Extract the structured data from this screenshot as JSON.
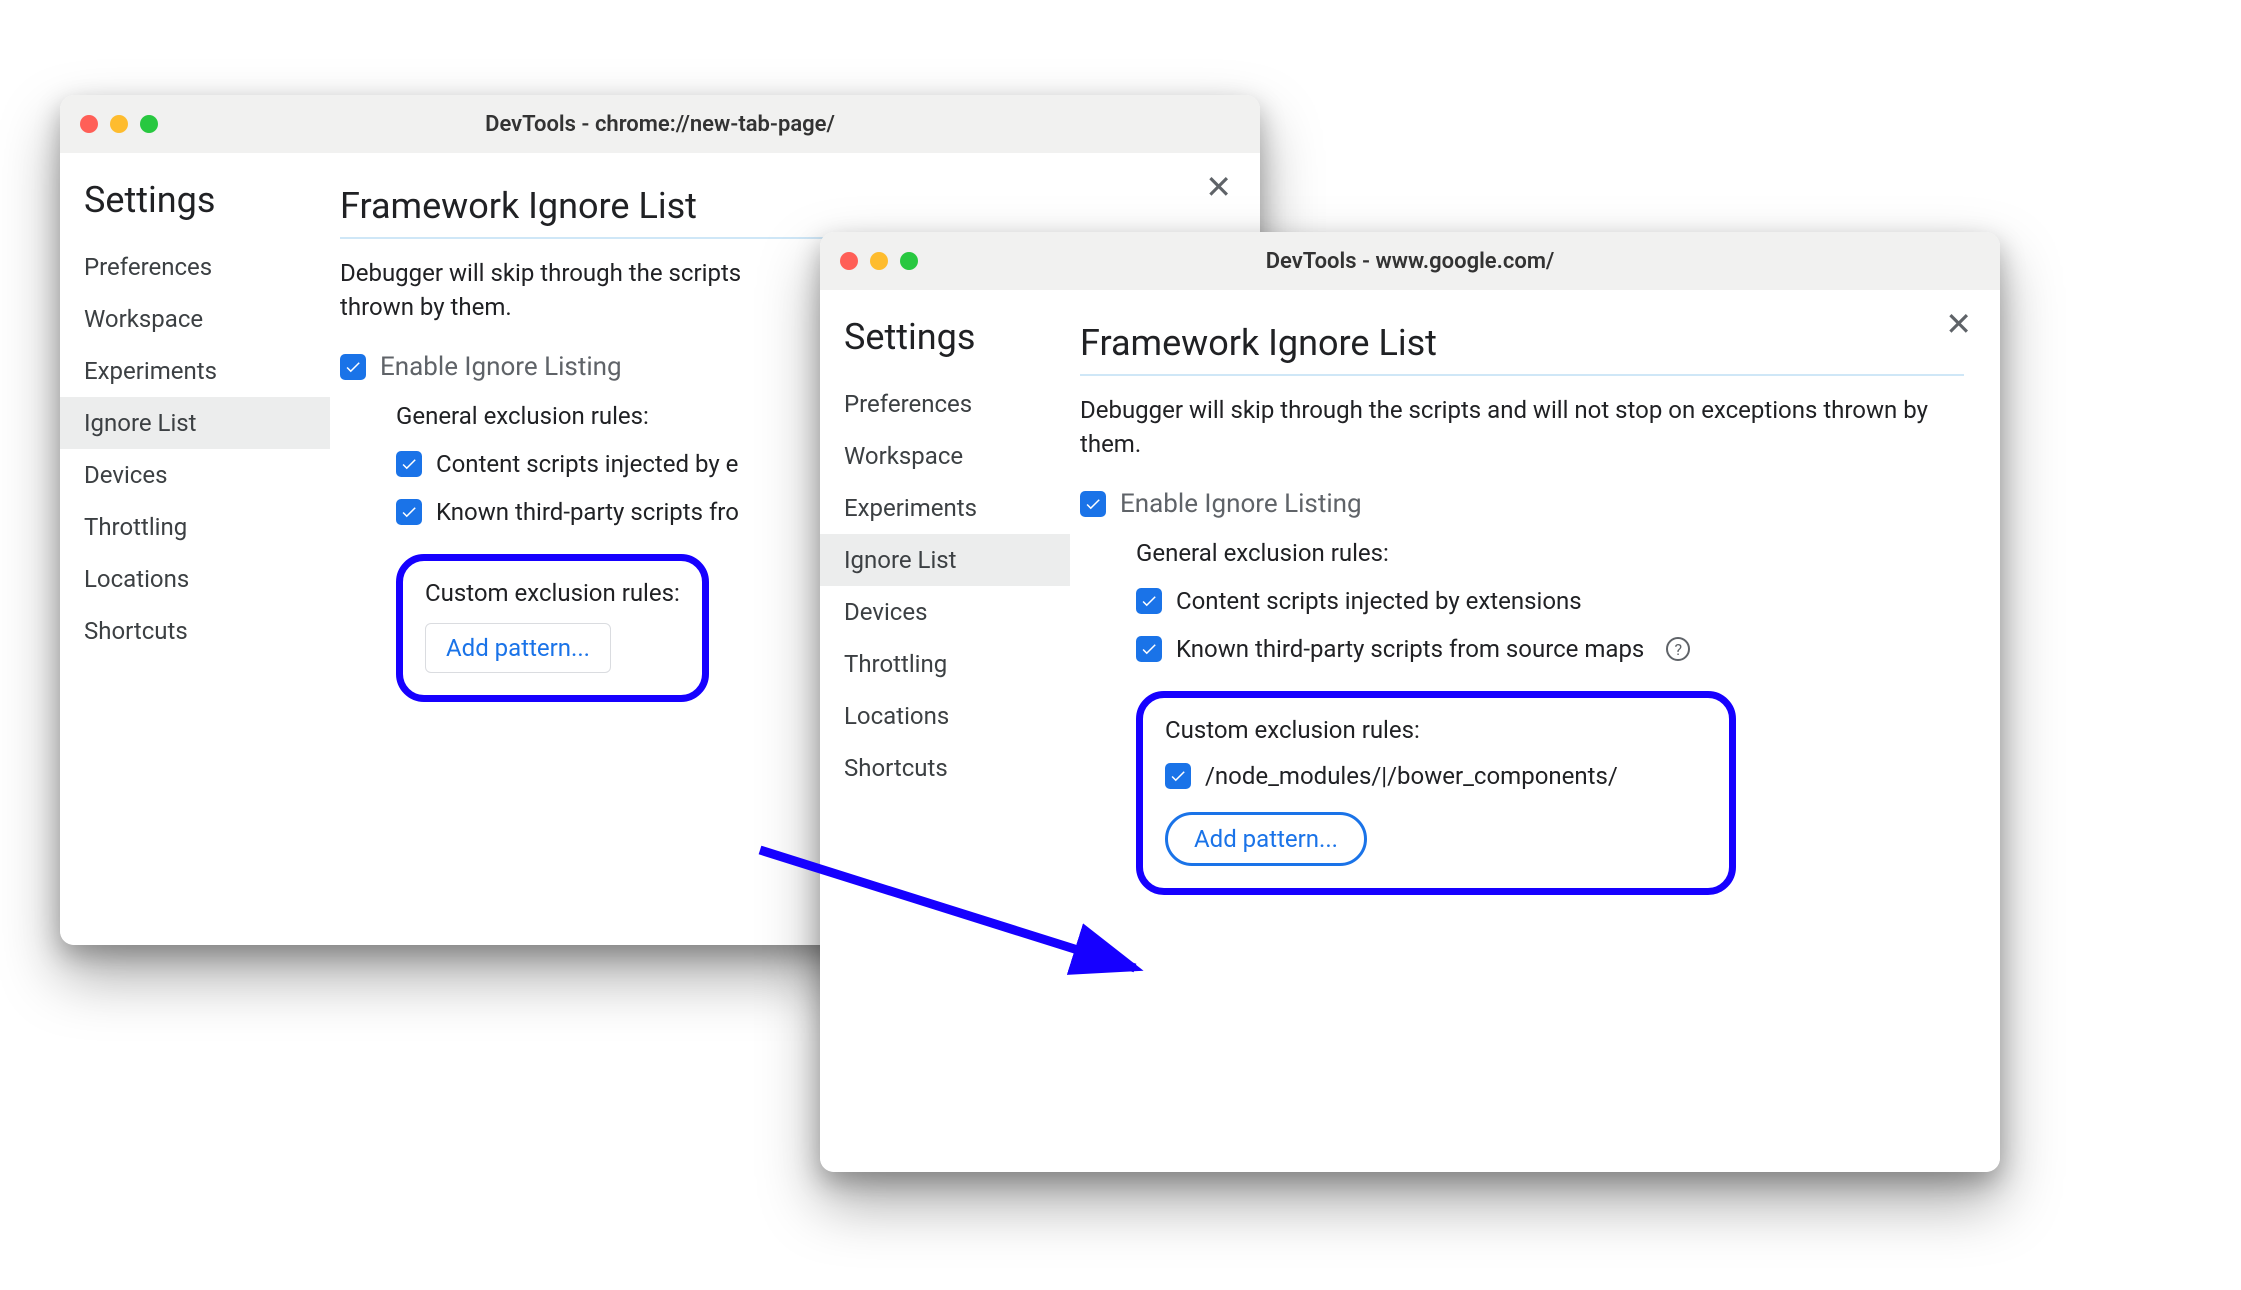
{
  "window1": {
    "title": "DevTools - chrome://new-tab-page/",
    "settings_label": "Settings",
    "sidebar": {
      "items": [
        {
          "label": "Preferences",
          "selected": false
        },
        {
          "label": "Workspace",
          "selected": false
        },
        {
          "label": "Experiments",
          "selected": false
        },
        {
          "label": "Ignore List",
          "selected": true
        },
        {
          "label": "Devices",
          "selected": false
        },
        {
          "label": "Throttling",
          "selected": false
        },
        {
          "label": "Locations",
          "selected": false
        },
        {
          "label": "Shortcuts",
          "selected": false
        }
      ]
    },
    "main": {
      "title": "Framework Ignore List",
      "description": "Debugger will skip through the scripts and will not stop on exceptions thrown by them.",
      "description_visible": "Debugger will skip through the scripts \nthrown by them.",
      "enable_label": "Enable Ignore Listing",
      "general_heading": "General exclusion rules:",
      "content_scripts_label": "Content scripts injected by e",
      "third_party_label": "Known third-party scripts fro",
      "custom_heading": "Custom exclusion rules:",
      "add_pattern_label": "Add pattern..."
    }
  },
  "window2": {
    "title": "DevTools - www.google.com/",
    "settings_label": "Settings",
    "sidebar": {
      "items": [
        {
          "label": "Preferences",
          "selected": false
        },
        {
          "label": "Workspace",
          "selected": false
        },
        {
          "label": "Experiments",
          "selected": false
        },
        {
          "label": "Ignore List",
          "selected": true
        },
        {
          "label": "Devices",
          "selected": false
        },
        {
          "label": "Throttling",
          "selected": false
        },
        {
          "label": "Locations",
          "selected": false
        },
        {
          "label": "Shortcuts",
          "selected": false
        }
      ]
    },
    "main": {
      "title": "Framework Ignore List",
      "description": "Debugger will skip through the scripts and will not stop on exceptions thrown by them.",
      "enable_label": "Enable Ignore Listing",
      "general_heading": "General exclusion rules:",
      "content_scripts_label": "Content scripts injected by extensions",
      "third_party_label": "Known third-party scripts from source maps",
      "custom_heading": "Custom exclusion rules:",
      "pattern_value": "/node_modules/|/bower_components/",
      "add_pattern_label": "Add pattern..."
    }
  }
}
